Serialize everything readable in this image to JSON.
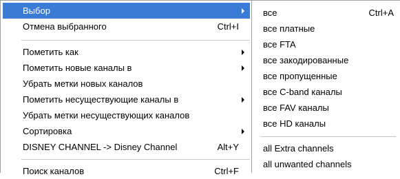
{
  "main_menu": {
    "items": [
      {
        "label": "Выбор",
        "shortcut": "",
        "submenu": true,
        "highlighted": true
      },
      {
        "label": "Отмена выбранного",
        "shortcut": "Ctrl+I",
        "submenu": false
      },
      {
        "label": "Пометить как",
        "shortcut": "",
        "submenu": true
      },
      {
        "label": "Пометить новые каналы в",
        "shortcut": "",
        "submenu": true
      },
      {
        "label": "Убрать метки новых каналов",
        "shortcut": "",
        "submenu": false
      },
      {
        "label": "Пометить несуществующие каналы в",
        "shortcut": "",
        "submenu": true
      },
      {
        "label": "Убрать метки несуществующих каналов",
        "shortcut": "",
        "submenu": false
      },
      {
        "label": "Сортировка",
        "shortcut": "",
        "submenu": true
      },
      {
        "label": "DISNEY CHANNEL -> Disney Channel",
        "shortcut": "Alt+Y",
        "submenu": false
      },
      {
        "label": "Поиск каналов",
        "shortcut": "Ctrl+F",
        "submenu": false
      }
    ]
  },
  "sub_menu": {
    "items": [
      {
        "label": "все",
        "shortcut": "Ctrl+A"
      },
      {
        "label": "все платные",
        "shortcut": ""
      },
      {
        "label": "все FTA",
        "shortcut": ""
      },
      {
        "label": "все закодированные",
        "shortcut": ""
      },
      {
        "label": "все пропущенные",
        "shortcut": ""
      },
      {
        "label": "все C-band каналы",
        "shortcut": ""
      },
      {
        "label": "все FAV каналы",
        "shortcut": ""
      },
      {
        "label": "все HD каналы",
        "shortcut": ""
      },
      {
        "label": "all Extra channels",
        "shortcut": ""
      },
      {
        "label": "all unwanted channels",
        "shortcut": ""
      }
    ]
  },
  "colors": {
    "highlight": "#3a7bd5",
    "separator": "#c8c8c8",
    "border": "#a0a0a0"
  },
  "icons": {
    "submenu_arrow": "chevron-right-icon"
  }
}
